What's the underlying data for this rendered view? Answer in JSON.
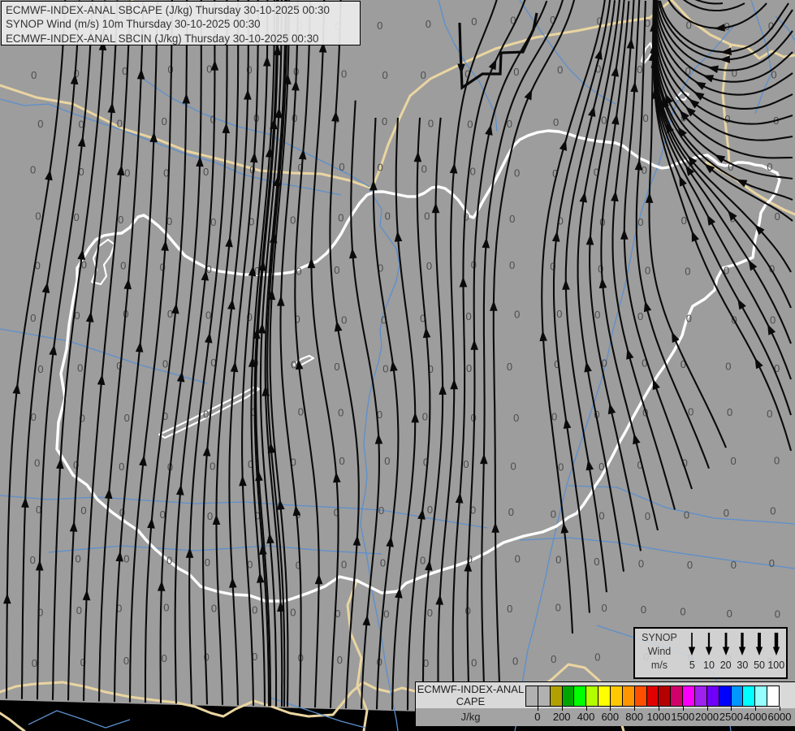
{
  "header": {
    "lines": [
      "ECMWF-INDEX-ANAL SBCAPE (J/kg) Thursday 30-10-2025 00:30",
      "SYNOP Wind (m/s) 10m Thursday 30-10-2025 00:30",
      "ECMWF-INDEX-ANAL SBCIN (J/kg) Thursday 30-10-2025 00:30"
    ]
  },
  "map": {
    "value_grid": {
      "value": "0",
      "columns": 18,
      "rows": 14
    },
    "colors": {
      "map_bg": "#9d9d9d",
      "map_edge": "#000000",
      "border_other": "#ead5a1",
      "river": "#5c8fcd",
      "border_hungary": "#ffffff",
      "streamline": "#0a0a0a",
      "grid_value_text": "#4c4c4c"
    }
  },
  "wind_legend": {
    "title_lines": [
      "SYNOP",
      "Wind",
      "m/s"
    ],
    "values": [
      "5",
      "10",
      "20",
      "30",
      "50",
      "100"
    ],
    "arrow_icon": "down-arrow-icon"
  },
  "cape_legend": {
    "title_lines": [
      "ECMWF-INDEX-ANAL",
      "CAPE"
    ],
    "unit": "J/kg",
    "ticks": [
      "0",
      "200",
      "400",
      "600",
      "800",
      "1000",
      "1500",
      "2000",
      "2500",
      "4000",
      "6000"
    ],
    "swatches": [
      "#b1b1b1",
      "#b1b1b1",
      "#b1a000",
      "#00a600",
      "#00ff00",
      "#b2ff00",
      "#ffff00",
      "#ffc800",
      "#ff9600",
      "#ff5000",
      "#e10000",
      "#b40000",
      "#d20069",
      "#fa00fa",
      "#a020f0",
      "#6e00fa",
      "#0000ff",
      "#0096ff",
      "#00ffff",
      "#96ffff",
      "#ffffff"
    ]
  }
}
